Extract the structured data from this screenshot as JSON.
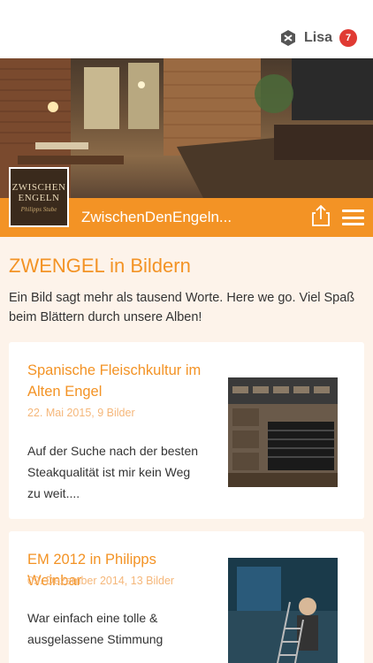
{
  "header": {
    "user_name": "Lisa",
    "notification_count": "7"
  },
  "brand": {
    "logo_line1": "ZWISCHEN",
    "logo_line2": "ENGELN",
    "logo_sub": "Philipps Stube",
    "site_title": "ZwischenDenEngeln...",
    "accent_color": "#f39325"
  },
  "page": {
    "heading": "ZWENGEL in Bildern",
    "intro": "Ein Bild sagt mehr als tausend Worte. Here we go. Viel Spaß beim Blättern durch unsere Alben!"
  },
  "albums": [
    {
      "title": "Spanische Fleischkultur im Alten Engel",
      "meta": "22. Mai 2015, 9 Bilder",
      "text": "Auf der Suche nach der besten Steakqualität ist mir kein Weg zu weit...."
    },
    {
      "title": "EM 2012 in Philipps Weinbar",
      "meta": "09. Dezember 2014, 13 Bilder",
      "text": "War einfach eine tolle & ausgelassene Stimmung"
    }
  ],
  "icons": {
    "user": "hexagon-logo-icon",
    "share": "share-icon",
    "menu": "hamburger-menu-icon"
  }
}
